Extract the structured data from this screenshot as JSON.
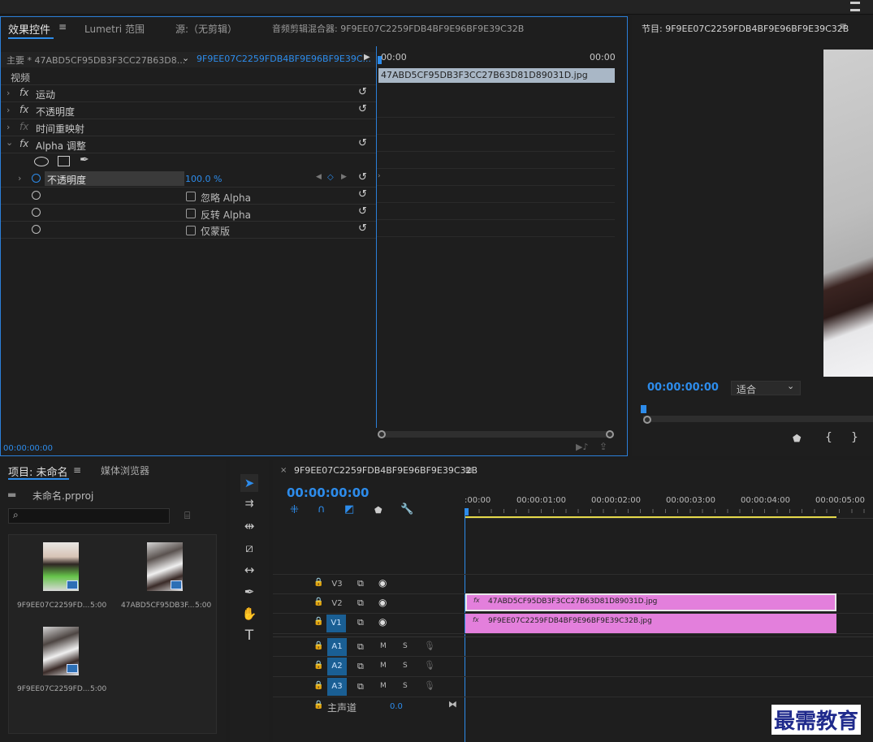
{
  "effect_controls": {
    "tabs": [
      "效果控件",
      "Lumetri 范围",
      "源:（无剪辑）",
      "音频剪辑混合器: 9F9EE07C2259FDB4BF9E96BF9E39C32B"
    ],
    "master_label": "主要 * 47ABD5CF95DB3F3CC27B63D8...",
    "clip_label": "9F9EE07C2259FDB4BF9E96BF9E39C...",
    "mini_time_start": "00:00",
    "mini_time_end": "00:00",
    "clip_bar": "47ABD5CF95DB3F3CC27B63D81D89031D.jpg",
    "video_header": "视频",
    "effects": [
      "运动",
      "不透明度",
      "时间重映射",
      "Alpha 调整"
    ],
    "prop_opacity": "不透明度",
    "prop_opacity_value": "100.0 %",
    "check_ignore": "忽略 Alpha",
    "check_invert": "反转 Alpha",
    "check_mask": "仅蒙版",
    "timecode": "00:00:00:00"
  },
  "program": {
    "title": "节目: 9F9EE07C2259FDB4BF9E96BF9E39C32B",
    "timecode": "00:00:00:00",
    "fit": "适合"
  },
  "project": {
    "tab_project": "项目: 未命名",
    "tab_media": "媒体浏览器",
    "file": "未命名.prproj",
    "items": [
      {
        "name": "9F9EE07C2259FD...",
        "dur": "5:00"
      },
      {
        "name": "47ABD5CF95DB3F...",
        "dur": "5:00"
      },
      {
        "name": "9F9EE07C2259FD...",
        "dur": "5:00"
      }
    ]
  },
  "timeline": {
    "title": "9F9EE07C2259FDB4BF9E96BF9E39C32B",
    "timecode": "00:00:00:00",
    "ruler": [
      ":00:00",
      "00:00:01:00",
      "00:00:02:00",
      "00:00:03:00",
      "00:00:04:00",
      "00:00:05:00"
    ],
    "video_tracks": [
      "V3",
      "V2",
      "V1"
    ],
    "audio_tracks": [
      "A1",
      "A2",
      "A3"
    ],
    "clip_v2": "47ABD5CF95DB3F3CC27B63D81D89031D.jpg",
    "clip_v1": "9F9EE07C2259FDB4BF9E96BF9E39C32B.jpg",
    "master": "主声道",
    "master_val": "0.0",
    "m": "M",
    "s": "S"
  },
  "watermark": "最需教育",
  "colors": {
    "accent": "#2d8ceb",
    "clip": "#e37fdc",
    "frame": "#2b7fd9"
  }
}
